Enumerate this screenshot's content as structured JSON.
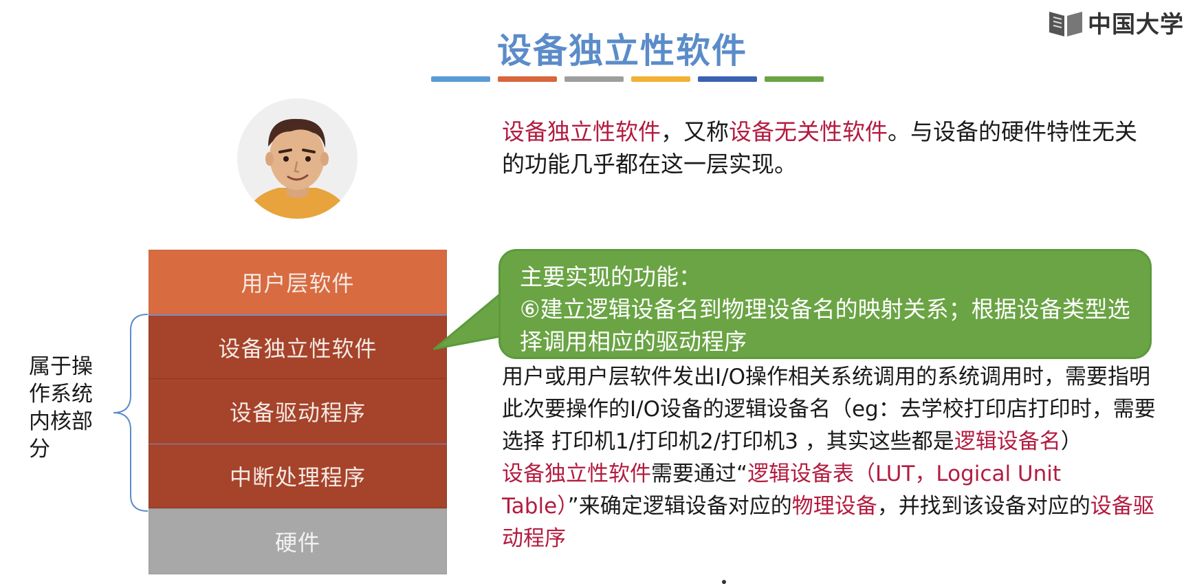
{
  "title": "设备独立性软件",
  "logo_text": "中国大学",
  "accent_bars": [
    "#5b9bd5",
    "#d9653b",
    "#9e9e9e",
    "#f2b134",
    "#3b62b0",
    "#6aa444"
  ],
  "intro": {
    "term1": "设备独立性软件",
    "text1": "，又称",
    "term2": "设备无关性软件",
    "text2": "。与设备的硬件特性无关的功能几乎都在这一层实现。"
  },
  "layers": {
    "user": "用户层软件",
    "device_independent": "设备独立性软件",
    "driver": "设备驱动程序",
    "interrupt": "中断处理程序",
    "hardware": "硬件"
  },
  "kernel_label": "属于操作系统内核部分",
  "callout": {
    "heading": "主要实现的功能：",
    "item": "⑥建立逻辑设备名到物理设备名的映射关系；根据设备类型选择调用相应的驱动程序"
  },
  "body": {
    "p1_text": "用户或用户层软件发出I/O操作相关系统调用的系统调用时，需要指明此次要操作的I/O设备的逻辑设备名（eg：去学校打印店打印时，需要选择 打印机1/打印机2/打印机3 ，其实这些都是",
    "p1_term": "逻辑设备名",
    "p1_end": "）",
    "p2_term1": "设备独立性软件",
    "p2_text1": "需要通过“",
    "p2_term2": "逻辑设备表（LUT，Logical Unit Table）",
    "p2_text2": "”来确定逻辑设备对应的",
    "p2_term3": "物理设备",
    "p2_text3": "，并找到该设备对应的",
    "p2_term4": "设备驱动程序"
  },
  "colors": {
    "title": "#5b8cc9",
    "highlight": "#b31b3f",
    "user_layer": "#d86b40",
    "kernel_layer": "#a6432b",
    "hardware_layer": "#a8a8a8",
    "callout": "#6aa444"
  }
}
